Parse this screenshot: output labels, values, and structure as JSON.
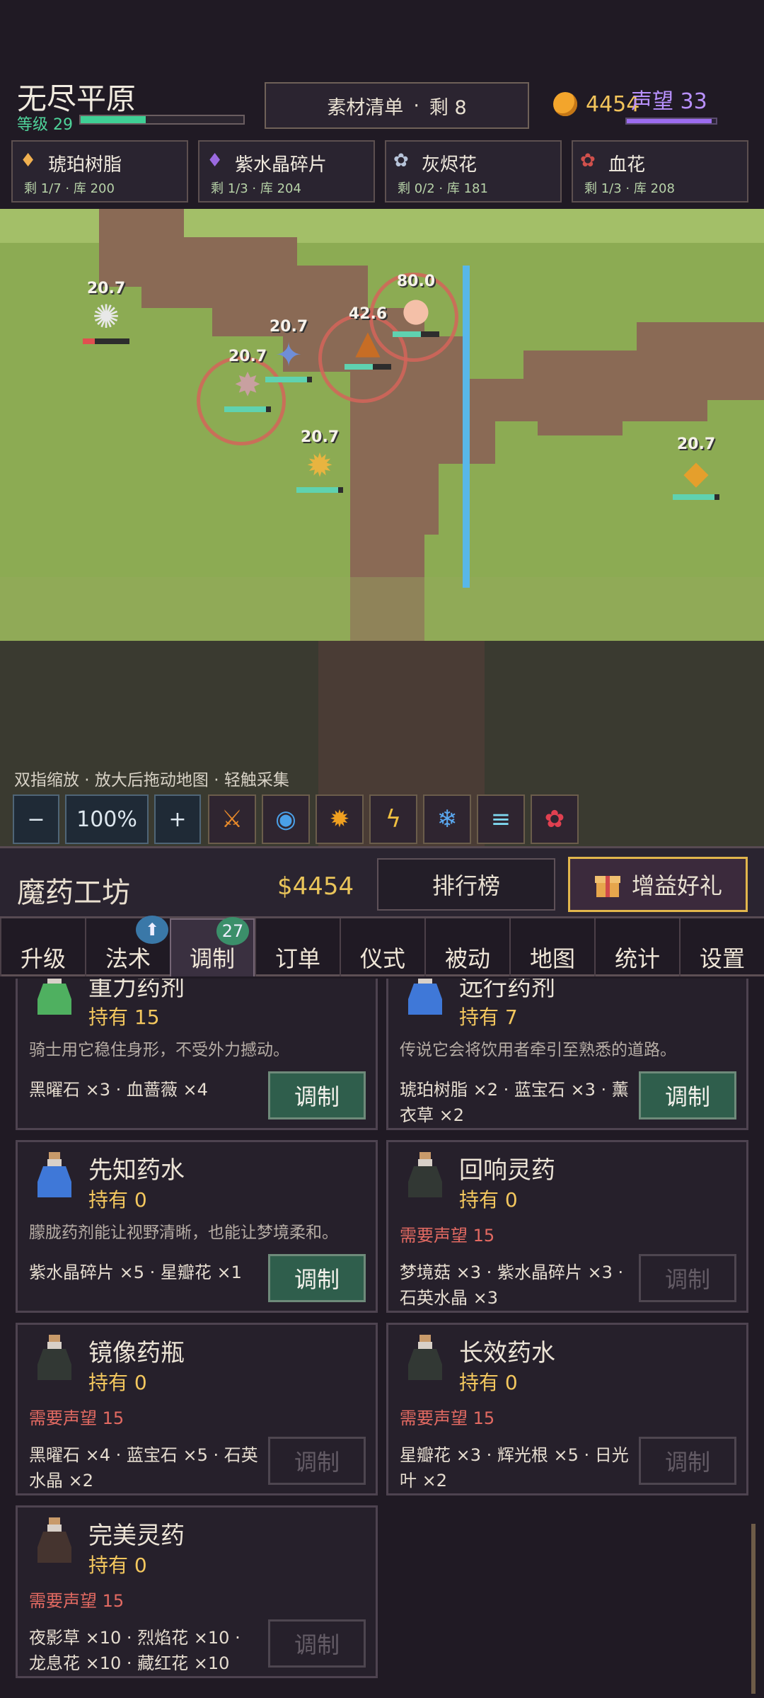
{
  "hud": {
    "region": "无尽平原",
    "level": "等级 29",
    "level_fraction": 0.4,
    "material_list": "素材清单",
    "material_sep": "·",
    "material_left": "剩 8",
    "gold": "4454",
    "reputation": "声望 33",
    "reputation_fraction": 0.95
  },
  "materials": [
    {
      "icon": "amber-resin-icon",
      "glyph": "♦",
      "color": "#f0b050",
      "name": "琥珀树脂",
      "stat": "剩 1/7 · 库 200"
    },
    {
      "icon": "purple-crystal-icon",
      "glyph": "♦",
      "color": "#9b6ae0",
      "name": "紫水晶碎片",
      "stat": "剩 1/3 · 库 204"
    },
    {
      "icon": "ash-flower-icon",
      "glyph": "✿",
      "color": "#b7c4d9",
      "name": "灰烬花",
      "stat": "剩 0/2 · 库 181"
    },
    {
      "icon": "blood-flower-icon",
      "glyph": "✿",
      "color": "#d0504c",
      "name": "血花",
      "stat": "剩 1/3 · 库 208"
    }
  ],
  "map_nodes": [
    {
      "label": "20.7",
      "hp": 0.25,
      "color": "#e8e8e8",
      "glyph": "✺",
      "hpcolor": "#e05050"
    },
    {
      "label": "20.7",
      "hp": 0.9,
      "color": "#6f8ed8",
      "glyph": "✦",
      "hpcolor": "#5fd2b0"
    },
    {
      "label": "20.7",
      "hp": 0.9,
      "color": "#c8a0a0",
      "glyph": "✸",
      "hpcolor": "#5fd2b0"
    },
    {
      "label": "42.6",
      "hp": 0.6,
      "color": "#c76d25",
      "glyph": "▲",
      "hpcolor": "#5fd2b0"
    },
    {
      "label": "80.0",
      "hp": 0.6,
      "color": "#f4c0a8",
      "glyph": "●",
      "hpcolor": "#5fd2b0"
    },
    {
      "label": "20.7",
      "hp": 0.9,
      "color": "#e8b440",
      "glyph": "✹",
      "hpcolor": "#5fd2b0"
    },
    {
      "label": "20.7",
      "hp": 0.9,
      "color": "#e59f2c",
      "glyph": "◆",
      "hpcolor": "#5fd2b0"
    }
  ],
  "hint": "双指缩放 · 放大后拖动地图 · 轻触采集",
  "toolbar": {
    "minus": "−",
    "zoom": "100%",
    "plus": "+"
  },
  "skills": [
    {
      "name": "skill-blade-icon",
      "glyph": "⚔",
      "color": "#e88a2a"
    },
    {
      "name": "skill-water-icon",
      "glyph": "◉",
      "color": "#4aa0e8"
    },
    {
      "name": "skill-fire-icon",
      "glyph": "✹",
      "color": "#f0a020"
    },
    {
      "name": "skill-lightning-icon",
      "glyph": "ϟ",
      "color": "#f0c040"
    },
    {
      "name": "skill-ice-icon",
      "glyph": "❄",
      "color": "#5aa8f0"
    },
    {
      "name": "skill-wave-icon",
      "glyph": "≡",
      "color": "#7fd8f0"
    },
    {
      "name": "skill-blossom-icon",
      "glyph": "✿",
      "color": "#e04050"
    }
  ],
  "workshop": {
    "title": "魔药工坊",
    "money": "$4454",
    "rank": "排行榜",
    "gift": "增益好礼"
  },
  "tabs": [
    {
      "label": "升级",
      "badge": ""
    },
    {
      "label": "法术",
      "badge": "⬆"
    },
    {
      "label": "调制",
      "badge": "27"
    },
    {
      "label": "订单",
      "badge": ""
    },
    {
      "label": "仪式",
      "badge": ""
    },
    {
      "label": "被动",
      "badge": ""
    },
    {
      "label": "地图",
      "badge": ""
    },
    {
      "label": "统计",
      "badge": ""
    },
    {
      "label": "设置",
      "badge": ""
    }
  ],
  "potions": [
    {
      "name": "重力药剂",
      "have": "持有 15",
      "desc": "骑士用它稳住身形，不受外力撼动。",
      "req": "",
      "mats": "黑曜石 ×3 · 血蔷薇 ×4",
      "btn": "调制",
      "enabled": true,
      "bottle": "#4fb060"
    },
    {
      "name": "远行药剂",
      "have": "持有 7",
      "desc": "传说它会将饮用者牵引至熟悉的道路。",
      "req": "",
      "mats": "琥珀树脂 ×2 · 蓝宝石 ×3 · 薰衣草 ×2",
      "btn": "调制",
      "enabled": true,
      "bottle": "#3f78d8"
    },
    {
      "name": "先知药水",
      "have": "持有 0",
      "desc": "朦胧药剂能让视野清晰，也能让梦境柔和。",
      "req": "",
      "mats": "紫水晶碎片 ×5 · 星瓣花 ×1",
      "btn": "调制",
      "enabled": true,
      "bottle": "#3f78d8"
    },
    {
      "name": "回响灵药",
      "have": "持有 0",
      "desc": "",
      "req": "需要声望 15",
      "mats": "梦境菇 ×3 · 紫水晶碎片 ×3 · 石英水晶 ×3",
      "btn": "调制",
      "enabled": false,
      "bottle": "#3a4a3a"
    },
    {
      "name": "镜像药瓶",
      "have": "持有 0",
      "desc": "",
      "req": "需要声望 15",
      "mats": "黑曜石 ×4 · 蓝宝石 ×5 · 石英水晶 ×2",
      "btn": "调制",
      "enabled": false,
      "bottle": "#3a4a3a"
    },
    {
      "name": "长效药水",
      "have": "持有 0",
      "desc": "",
      "req": "需要声望 15",
      "mats": "星瓣花 ×3 · 辉光根 ×5 · 日光叶 ×2",
      "btn": "调制",
      "enabled": false,
      "bottle": "#3a4a3a"
    },
    {
      "name": "完美灵药",
      "have": "持有 0",
      "desc": "",
      "req": "需要声望 15",
      "mats": "夜影草 ×10 · 烈焰花 ×10 · 龙息花 ×10 · 藏红花 ×10",
      "btn": "调制",
      "enabled": false,
      "bottle": "#5a4232"
    }
  ]
}
